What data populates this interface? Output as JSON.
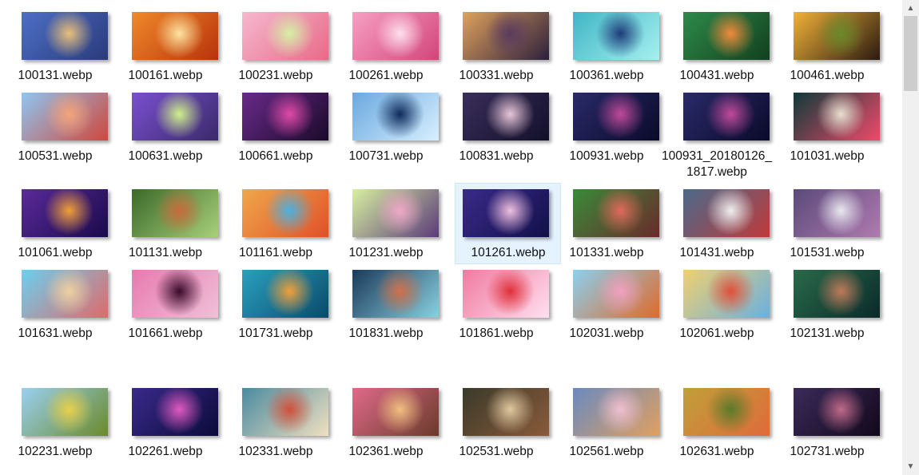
{
  "files": [
    {
      "name": "100131.webp",
      "colors": [
        "#4d6fc6",
        "#e9c07a",
        "#2a3a7a"
      ]
    },
    {
      "name": "100161.webp",
      "colors": [
        "#f08a2a",
        "#fde3a0",
        "#b8320c"
      ]
    },
    {
      "name": "100231.webp",
      "colors": [
        "#f6b8cf",
        "#d6f0a6",
        "#e86a88"
      ]
    },
    {
      "name": "100261.webp",
      "colors": [
        "#f7a0c4",
        "#ffe0ee",
        "#d2457a"
      ]
    },
    {
      "name": "100331.webp",
      "colors": [
        "#e0a25c",
        "#5a3a5e",
        "#2c1f3c"
      ]
    },
    {
      "name": "100361.webp",
      "colors": [
        "#3fb6c5",
        "#1e3c7a",
        "#a6f0f0"
      ]
    },
    {
      "name": "100431.webp",
      "colors": [
        "#2e8a4a",
        "#f08a3a",
        "#12401f"
      ]
    },
    {
      "name": "100461.webp",
      "colors": [
        "#f2b23a",
        "#6a8a2a",
        "#2a1a10"
      ]
    },
    {
      "name": "100531.webp",
      "colors": [
        "#8ec6f2",
        "#f5a57a",
        "#d0473c"
      ]
    },
    {
      "name": "100631.webp",
      "colors": [
        "#7a4fd0",
        "#d0f08a",
        "#3a2a6a"
      ]
    },
    {
      "name": "100661.webp",
      "colors": [
        "#6a2a8a",
        "#e04aa8",
        "#1a0a2a"
      ]
    },
    {
      "name": "100731.webp",
      "colors": [
        "#6aa8e0",
        "#0e2a5a",
        "#d8f0ff"
      ]
    },
    {
      "name": "100831.webp",
      "colors": [
        "#3a2e5a",
        "#e8c6d8",
        "#12102a"
      ]
    },
    {
      "name": "100931.webp",
      "colors": [
        "#2a2a6a",
        "#c04a9a",
        "#0a0a2a"
      ]
    },
    {
      "name": "100931_20180126_1817.webp",
      "colors": [
        "#2a2a6a",
        "#c04a9a",
        "#0a0a2a"
      ]
    },
    {
      "name": "101031.webp",
      "colors": [
        "#0e3a3a",
        "#e8e0d0",
        "#f04a6a"
      ]
    },
    {
      "name": "101061.webp",
      "colors": [
        "#5a2a9a",
        "#f0a03a",
        "#1a0a4a"
      ]
    },
    {
      "name": "101131.webp",
      "colors": [
        "#3a6a2a",
        "#c86a3a",
        "#a8d07a"
      ]
    },
    {
      "name": "101161.webp",
      "colors": [
        "#f0a84a",
        "#4ab0e0",
        "#e0502a"
      ]
    },
    {
      "name": "101231.webp",
      "colors": [
        "#d8f0a0",
        "#f0a8c8",
        "#5a3a7a"
      ]
    },
    {
      "name": "101261.webp",
      "colors": [
        "#3a2a8a",
        "#f0c0e0",
        "#12104a"
      ]
    },
    {
      "name": "101331.webp",
      "colors": [
        "#3a8a3a",
        "#e06a5a",
        "#6a2a2a"
      ]
    },
    {
      "name": "101431.webp",
      "colors": [
        "#4a6a8a",
        "#f0f0f0",
        "#c03a3a"
      ]
    },
    {
      "name": "101531.webp",
      "colors": [
        "#5a4a7a",
        "#e8e8f0",
        "#b07ab0"
      ]
    },
    {
      "name": "101631.webp",
      "colors": [
        "#6ad0f0",
        "#f0d0a0",
        "#e06a6a"
      ]
    },
    {
      "name": "101661.webp",
      "colors": [
        "#e87ab0",
        "#3a0a2a",
        "#f0c0d8"
      ]
    },
    {
      "name": "101731.webp",
      "colors": [
        "#2aa0c0",
        "#f0a03a",
        "#0a4a6a"
      ]
    },
    {
      "name": "101831.webp",
      "colors": [
        "#1a3a5a",
        "#d0704a",
        "#8ad0e0"
      ]
    },
    {
      "name": "101861.webp",
      "colors": [
        "#f07aa0",
        "#e0303a",
        "#ffe0f0"
      ]
    },
    {
      "name": "102031.webp",
      "colors": [
        "#8ad0f0",
        "#f0a0c0",
        "#e06a2a"
      ]
    },
    {
      "name": "102061.webp",
      "colors": [
        "#f0d070",
        "#e0503a",
        "#6ab0e0"
      ]
    },
    {
      "name": "102131.webp",
      "colors": [
        "#2a6a4a",
        "#c07a5a",
        "#0a2a2a"
      ]
    },
    {
      "name": "102231.webp",
      "colors": [
        "#9ad0f0",
        "#e8d04a",
        "#6a8a2a"
      ]
    },
    {
      "name": "102261.webp",
      "colors": [
        "#3a2a8a",
        "#e05ac0",
        "#0a0a3a"
      ]
    },
    {
      "name": "102331.webp",
      "colors": [
        "#4a8aa0",
        "#d0503a",
        "#f0e0c0"
      ]
    },
    {
      "name": "102361.webp",
      "colors": [
        "#e06a8a",
        "#f0c080",
        "#6a3a2a"
      ]
    },
    {
      "name": "102531.webp",
      "colors": [
        "#3a3a2a",
        "#e0c8a0",
        "#8a5a3a"
      ]
    },
    {
      "name": "102561.webp",
      "colors": [
        "#6a8ac0",
        "#f0c0d0",
        "#e0a060"
      ]
    },
    {
      "name": "102631.webp",
      "colors": [
        "#c0a03a",
        "#5a7a2a",
        "#e06a3a"
      ]
    },
    {
      "name": "102731.webp",
      "colors": [
        "#3a2a5a",
        "#c06a8a",
        "#12081a"
      ]
    }
  ],
  "selected_file": "101261.webp",
  "scrollbar": {
    "up_icon": "chevron-up-icon",
    "down_icon": "chevron-down-icon"
  }
}
